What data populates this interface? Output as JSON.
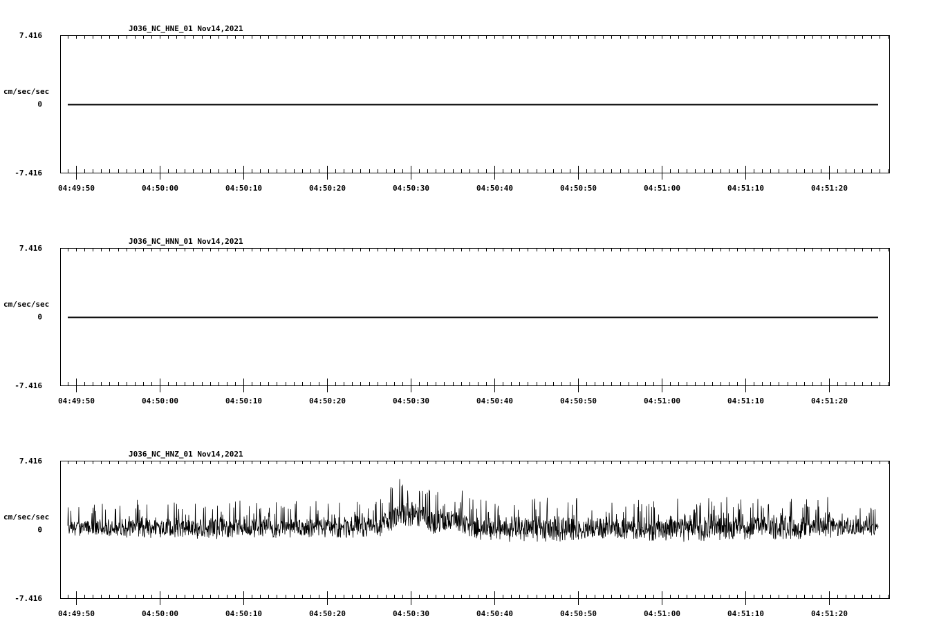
{
  "chart_data": [
    {
      "type": "line",
      "title": "J036_NC_HNE_01   Nov14,2021",
      "ylabel": "cm/sec/sec",
      "ylim": [
        -7.416,
        7.416
      ],
      "yticks": [
        "7.416",
        "0",
        "-7.416"
      ],
      "xticks": [
        "04:49:50",
        "04:50:00",
        "04:50:10",
        "04:50:20",
        "04:50:30",
        "04:50:40",
        "04:50:50",
        "04:51:00",
        "04:51:10",
        "04:51:20"
      ],
      "x_range": [
        "04:49:49",
        "04:51:26"
      ],
      "series": [
        {
          "values": [
            [
              0,
              0
            ],
            [
              97,
              0
            ]
          ]
        }
      ]
    },
    {
      "type": "line",
      "title": "J036_NC_HNN_01   Nov14,2021",
      "ylabel": "cm/sec/sec",
      "ylim": [
        -7.416,
        7.416
      ],
      "yticks": [
        "7.416",
        "0",
        "-7.416"
      ],
      "xticks": [
        "04:49:50",
        "04:50:00",
        "04:50:10",
        "04:50:20",
        "04:50:30",
        "04:50:40",
        "04:50:50",
        "04:51:00",
        "04:51:10",
        "04:51:20"
      ],
      "x_range": [
        "04:49:49",
        "04:51:26"
      ],
      "series": [
        {
          "values": [
            [
              0,
              0
            ],
            [
              97,
              0
            ]
          ]
        }
      ]
    },
    {
      "type": "line",
      "title": "J036_NC_HNZ_01   Nov14,2021",
      "ylabel": "cm/sec/sec",
      "ylim": [
        -7.416,
        7.416
      ],
      "yticks": [
        "7.416",
        "0",
        "-7.416"
      ],
      "xticks": [
        "04:49:50",
        "04:50:00",
        "04:50:10",
        "04:50:20",
        "04:50:30",
        "04:50:40",
        "04:50:50",
        "04:51:00",
        "04:51:10",
        "04:51:20"
      ],
      "x_range": [
        "04:49:49",
        "04:51:26"
      ],
      "series": [
        {
          "envelope": [
            {
              "t": "04:49:49",
              "low": -0.8,
              "high": 2.5
            },
            {
              "t": "04:49:55",
              "low": -1.0,
              "high": 3.0
            },
            {
              "t": "04:50:00",
              "low": -1.0,
              "high": 3.5
            },
            {
              "t": "04:50:05",
              "low": -1.2,
              "high": 3.3
            },
            {
              "t": "04:50:10",
              "low": -1.0,
              "high": 3.2
            },
            {
              "t": "04:50:15",
              "low": -1.1,
              "high": 3.0
            },
            {
              "t": "04:50:20",
              "low": -1.0,
              "high": 3.4
            },
            {
              "t": "04:50:26",
              "low": -1.2,
              "high": 3.5
            },
            {
              "t": "04:50:29",
              "low": 0.5,
              "high": 6.5
            },
            {
              "t": "04:50:30",
              "low": 0.5,
              "high": 7.0
            },
            {
              "t": "04:50:32",
              "low": 0.0,
              "high": 5.5
            },
            {
              "t": "04:50:33",
              "low": -0.8,
              "high": 4.2
            },
            {
              "t": "04:50:35",
              "low": 0.0,
              "high": 5.0
            },
            {
              "t": "04:50:37",
              "low": -1.0,
              "high": 4.0
            },
            {
              "t": "04:50:40",
              "low": -1.5,
              "high": 2.8
            },
            {
              "t": "04:50:47",
              "low": -1.5,
              "high": 4.2
            },
            {
              "t": "04:50:55",
              "low": -1.2,
              "high": 3.0
            },
            {
              "t": "04:51:00",
              "low": -1.4,
              "high": 3.5
            },
            {
              "t": "04:51:10",
              "low": -1.3,
              "high": 3.5
            },
            {
              "t": "04:51:20",
              "low": -1.0,
              "high": 3.6
            },
            {
              "t": "04:51:26",
              "low": -0.7,
              "high": 2.6
            }
          ]
        }
      ]
    }
  ]
}
